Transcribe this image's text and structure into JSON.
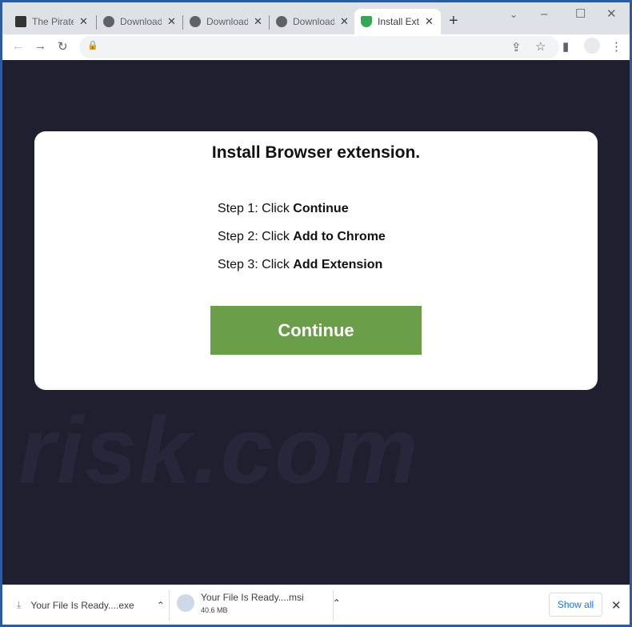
{
  "tabs": [
    {
      "label": "The Pirate Bay",
      "icon": "pirate-ship-icon"
    },
    {
      "label": "Download",
      "icon": "globe-icon"
    },
    {
      "label": "Download",
      "icon": "globe-icon"
    },
    {
      "label": "Download",
      "icon": "globe-icon"
    },
    {
      "label": "Install Extension",
      "icon": "shield-check-icon",
      "active": true
    }
  ],
  "page": {
    "title": "Install Browser extension.",
    "steps": [
      {
        "prefix": "Step 1: Click ",
        "bold": "Continue"
      },
      {
        "prefix": "Step 2: Click ",
        "bold": "Add to Chrome"
      },
      {
        "prefix": "Step 3: Click ",
        "bold": "Add Extension"
      }
    ],
    "button": "Continue",
    "button_color": "#6b9e48",
    "watermark": "risk.com"
  },
  "downloads": [
    {
      "name": "Your File Is Ready....exe"
    },
    {
      "name": "Your File Is Ready....msi",
      "size": "40.6 MB"
    }
  ],
  "show_all": "Show all"
}
